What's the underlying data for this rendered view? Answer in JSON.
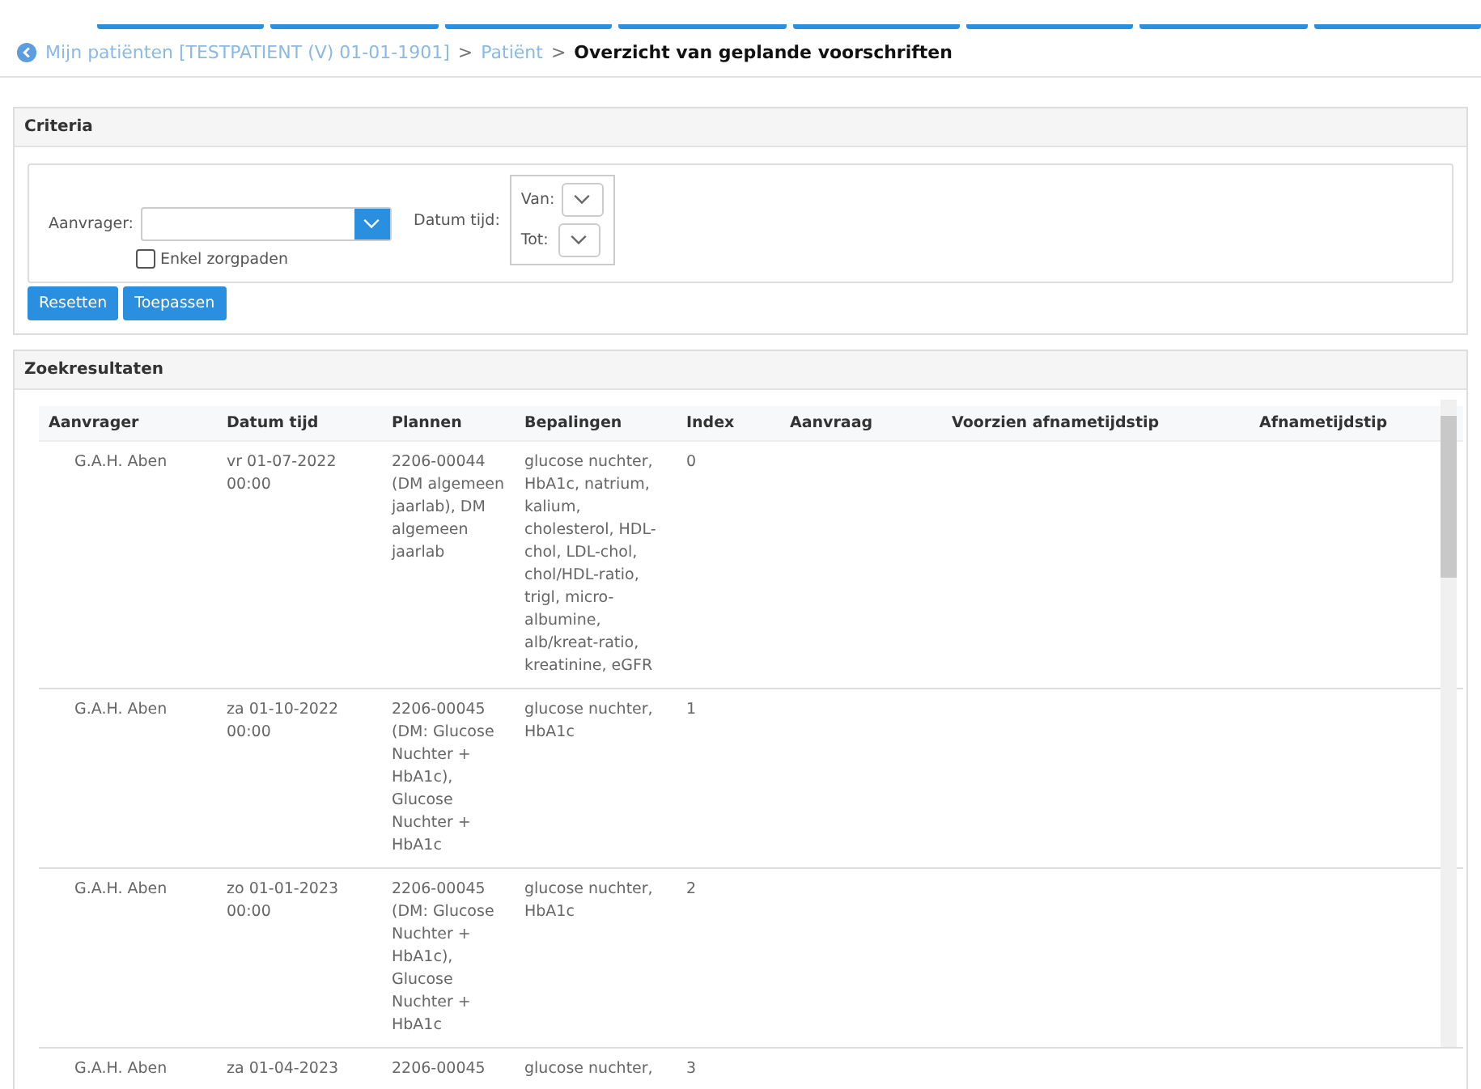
{
  "breadcrumb": {
    "links": [
      "Mijn patiënten [TESTPATIENT (V) 01-01-1901]",
      "Patiënt"
    ],
    "separators": [
      ">",
      ">"
    ],
    "current": "Overzicht van geplande voorschriften"
  },
  "criteria": {
    "title": "Criteria",
    "aanvrager_label": "Aanvrager:",
    "checkbox": {
      "label": "Enkel zorgpaden",
      "checked": false
    },
    "datum_label": "Datum tijd:",
    "van_label": "Van:",
    "tot_label": "Tot:",
    "buttons": [
      "Resetten",
      "Toepassen"
    ]
  },
  "results": {
    "title": "Zoekresultaten",
    "columns": [
      "Aanvrager",
      "Datum tijd",
      "Plannen",
      "Bepalingen",
      "Index",
      "Aanvraag",
      "Voorzien afnametijdstip",
      "Afnametijdstip"
    ],
    "rows": [
      [
        "G.A.H. Aben",
        "vr 01-07-2022 00:00",
        "2206-00044 (DM algemeen jaarlab), DM algemeen jaarlab",
        "glucose nuchter, HbA1c, natrium, kalium, cholesterol, HDL-chol, LDL-chol, chol/HDL-ratio, trigl, micro-albumine, alb/kreat-ratio, kreatinine, eGFR",
        "0"
      ],
      [
        "G.A.H. Aben",
        "za 01-10-2022 00:00",
        "2206-00045 (DM: Glucose Nuchter + HbA1c), Glucose Nuchter + HbA1c",
        "glucose nuchter, HbA1c",
        "1"
      ],
      [
        "G.A.H. Aben",
        "zo 01-01-2023 00:00",
        "2206-00045 (DM: Glucose Nuchter + HbA1c), Glucose Nuchter + HbA1c",
        "glucose nuchter, HbA1c",
        "2"
      ],
      [
        "G.A.H. Aben",
        "za 01-04-2023",
        "2206-00045",
        "glucose nuchter,",
        "3"
      ]
    ]
  }
}
